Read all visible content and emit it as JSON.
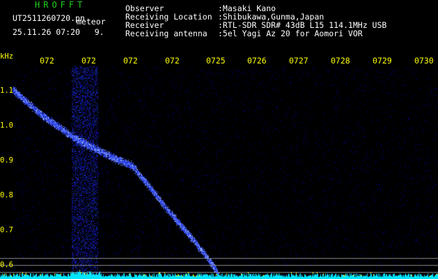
{
  "header": {
    "app_title": "HROFFT",
    "file_name": "UT2511260720.pn",
    "meteor_tag": "meteor",
    "date_time": "25.11.26 07:20   9.",
    "info_labels": "Observer\nReceiving Location\nReceiver\nReceiving antenna",
    "info_values": ":Masaki Kano\n:Shibukawa,Gunma,Japan\n:RTL-SDR SDR# 43dB L15 114.1MHz USB\n:5el Yagi Az 20 for Aomori VOR"
  },
  "x_ticks": [
    "072",
    "072",
    "072",
    "072",
    "0725",
    "0726",
    "0727",
    "0728",
    "0729",
    "0730"
  ],
  "y_unit": "kHz",
  "y_ticks": [
    "1.1",
    "1.0",
    "0.9",
    "0.8",
    "0.7",
    "0.6"
  ],
  "colors": {
    "background": "#000000",
    "labels": "#ffff00",
    "title": "#1ed41e",
    "trail": "#4a64ff",
    "noise_floor": "#00ffff"
  }
}
